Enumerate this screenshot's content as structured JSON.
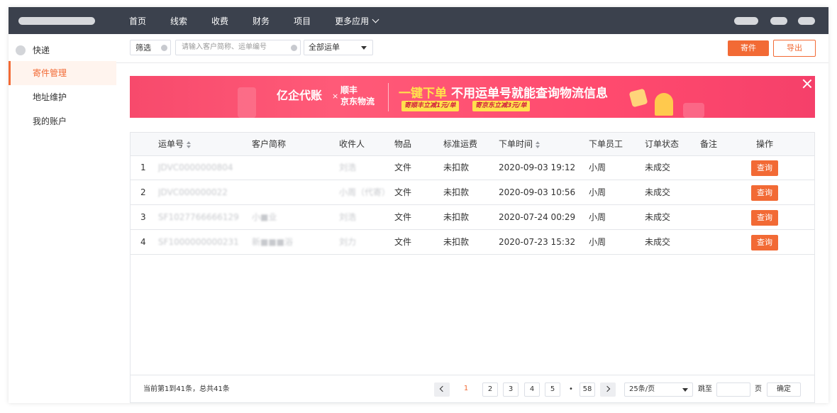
{
  "nav": {
    "items": [
      "首页",
      "线索",
      "收费",
      "财务",
      "项目",
      "更多应用"
    ]
  },
  "sidebar": {
    "section": "快递",
    "items": [
      {
        "label": "寄件管理",
        "active": true
      },
      {
        "label": "地址维护",
        "active": false
      },
      {
        "label": "我的账户",
        "active": false
      }
    ]
  },
  "toolbar": {
    "filter_label": "筛选",
    "search_placeholder": "请输入客户简称、运单编号",
    "waybill_select": "全部运单",
    "send_button": "寄件",
    "export_button": "导出"
  },
  "banner": {
    "logo_text": "亿企代账",
    "x_mark": "×",
    "brand_1": "顺丰",
    "brand_2": "京东物流",
    "headline_highlight": "一键下单",
    "headline_rest": "不用运单号就能查询物流信息",
    "tag_1": "寄顺丰立减1元/单",
    "tag_2": "寄京东立减3元/单"
  },
  "table": {
    "columns": [
      "运单号",
      "客户简称",
      "收件人",
      "物品",
      "标准运费",
      "下单时间",
      "下单员工",
      "订单状态",
      "备注",
      "操作"
    ],
    "rows": [
      {
        "index": "1",
        "waybill": "JDVC0000000804",
        "customer": "",
        "recipient": "刘浩",
        "item": "文件",
        "fee": "未扣款",
        "time": "2020-09-03 19:12",
        "staff": "小周",
        "status": "未成交",
        "note": "",
        "action": "查询"
      },
      {
        "index": "2",
        "waybill": "JDVC000000022",
        "customer": "",
        "recipient": "小周（代寄）…",
        "item": "文件",
        "fee": "未扣款",
        "time": "2020-09-03 10:56",
        "staff": "小周",
        "status": "未成交",
        "note": "",
        "action": "查询"
      },
      {
        "index": "3",
        "waybill": "SF1027766666129",
        "customer": "小■业",
        "recipient": "刘浩",
        "item": "文件",
        "fee": "未扣款",
        "time": "2020-07-24 00:29",
        "staff": "小周",
        "status": "未成交",
        "note": "",
        "action": "查询"
      },
      {
        "index": "4",
        "waybill": "SF1000000000231",
        "customer": "新■■■浴",
        "recipient": "刘力",
        "item": "文件",
        "fee": "未扣款",
        "time": "2020-07-23 15:32",
        "staff": "小周",
        "status": "未成交",
        "note": "",
        "action": "查询"
      }
    ]
  },
  "pagination": {
    "summary": "当前第1到41条，总共41条",
    "pages": [
      "1",
      "2",
      "3",
      "4",
      "5"
    ],
    "ellipsis": "•",
    "last_page": "58",
    "current_page": "1",
    "page_size": "25条/页",
    "jump_label": "跳至",
    "page_suffix": "页",
    "confirm": "确定"
  },
  "colors": {
    "accent": "#f26a35",
    "topbar": "#3b414d",
    "banner": "#ff4a6e"
  }
}
